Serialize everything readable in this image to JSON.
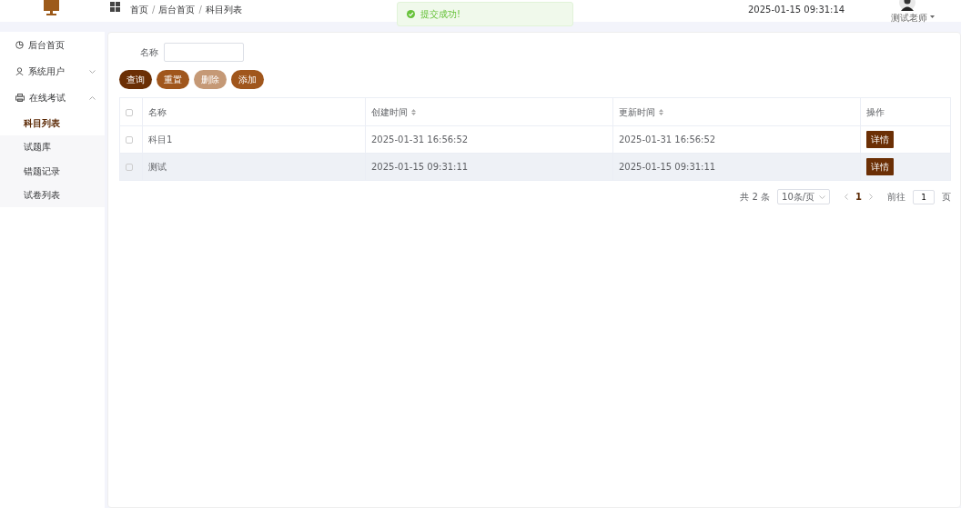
{
  "header": {
    "breadcrumb": [
      "首页",
      "后台首页",
      "科目列表"
    ],
    "separator": "/",
    "datetime": "2025-01-15 09:31:14",
    "user": "测试老师"
  },
  "toast": {
    "message": "提交成功!"
  },
  "sidebar": {
    "items": [
      {
        "label": "后台首页",
        "kind": "link"
      },
      {
        "label": "系统用户",
        "kind": "group",
        "expanded": false
      },
      {
        "label": "在线考试",
        "kind": "group",
        "expanded": true,
        "children": [
          {
            "label": "科目列表",
            "selected": true
          },
          {
            "label": "试题库",
            "selected": false
          },
          {
            "label": "错题记录",
            "selected": false
          },
          {
            "label": "试卷列表",
            "selected": false
          }
        ]
      }
    ]
  },
  "search": {
    "label": "名称"
  },
  "buttons": [
    {
      "label": "查询",
      "kind": "query",
      "disabled": false
    },
    {
      "label": "重置",
      "kind": "reset",
      "disabled": false
    },
    {
      "label": "删除",
      "kind": "delete",
      "disabled": true
    },
    {
      "label": "添加",
      "kind": "add",
      "disabled": false
    }
  ],
  "table": {
    "select_all": {
      "checked": false
    },
    "columns": [
      {
        "label": "名称",
        "sortable": false
      },
      {
        "label": "创建时间",
        "sortable": true
      },
      {
        "label": "更新时间",
        "sortable": true
      },
      {
        "label": "操作",
        "sortable": false
      }
    ],
    "rows": [
      {
        "checked": false,
        "highlighted": false,
        "cells": [
          "科目1",
          "2025-01-31 16:56:52",
          "2025-01-31 16:56:52"
        ],
        "action": "详情"
      },
      {
        "checked": false,
        "highlighted": true,
        "cells": [
          "测试",
          "2025-01-15 09:31:11",
          "2025-01-15 09:31:11"
        ],
        "action": "详情"
      }
    ]
  },
  "pagination": {
    "total": "共 2 条",
    "page_size": "10条/页",
    "pages": [
      {
        "label": "1",
        "selected": true
      }
    ],
    "jump_label": "前往",
    "jump_value": "1",
    "jump_suffix": "页"
  }
}
